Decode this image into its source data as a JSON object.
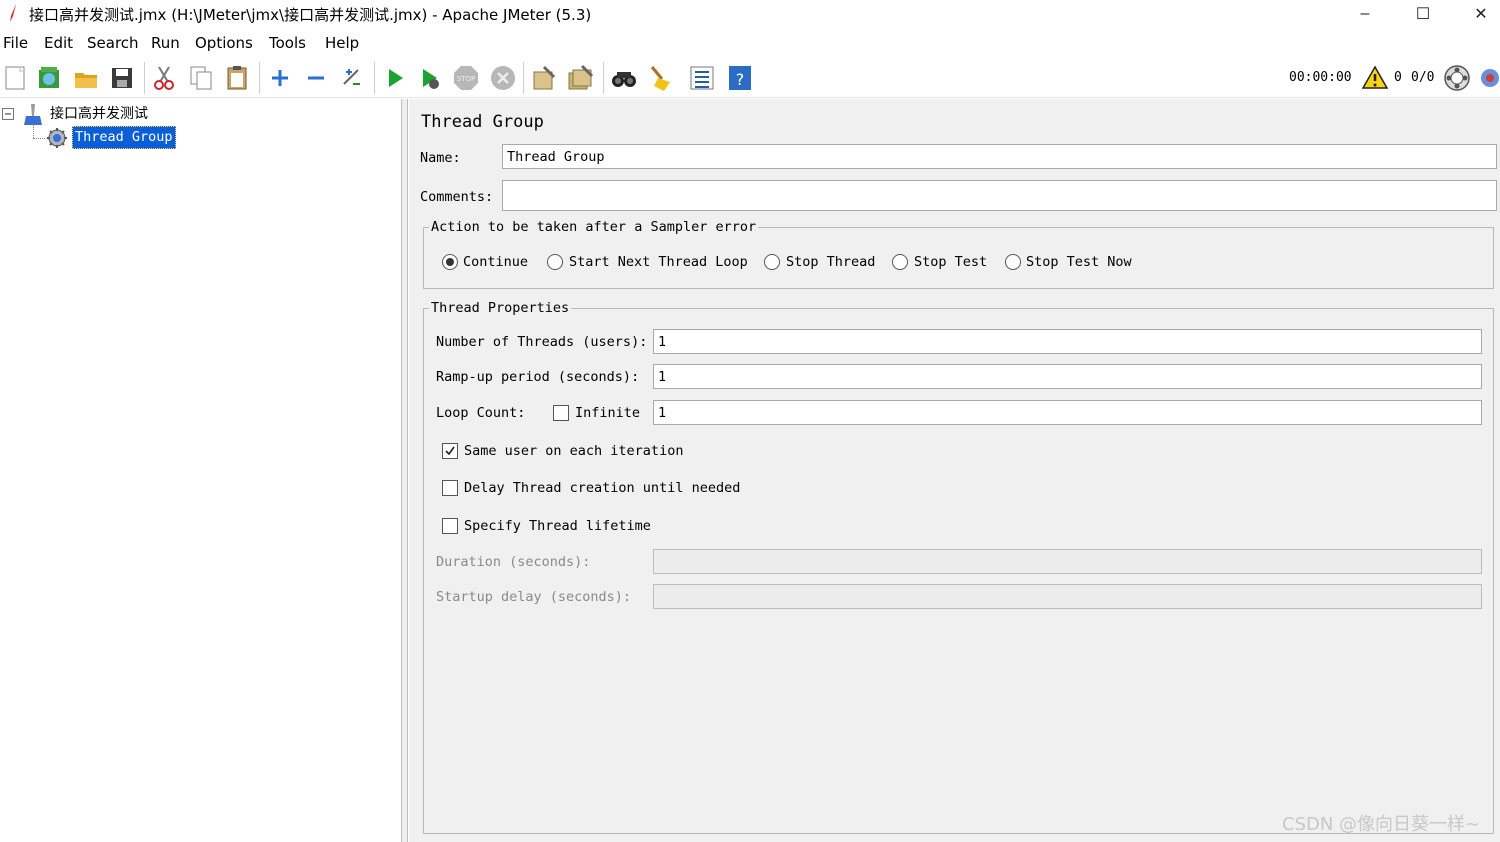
{
  "window": {
    "title": "接口高并发测试.jmx (H:\\JMeter\\jmx\\接口高并发测试.jmx) - Apache JMeter (5.3)",
    "controls": {
      "minimize": "–",
      "maximize": "☐",
      "close": "✕"
    }
  },
  "menu": [
    "File",
    "Edit",
    "Search",
    "Run",
    "Options",
    "Tools",
    "Help"
  ],
  "toolbar": {
    "timer": "00:00:00",
    "warning_count": "0",
    "thread_count": "0/0",
    "icons": [
      "new-icon",
      "templates-icon",
      "open-icon",
      "save-icon",
      "cut-icon",
      "copy-icon",
      "paste-icon",
      "expand-icon",
      "collapse-icon",
      "toggle-icon",
      "start-icon",
      "start-no-pause-icon",
      "stop-icon",
      "shutdown-icon",
      "clear-icon",
      "clear-all-icon",
      "search-icon",
      "reset-search-icon",
      "function-helper-icon",
      "help-icon"
    ]
  },
  "tree": {
    "root_label": "接口高并发测试",
    "child_label": "Thread Group"
  },
  "panel": {
    "title": "Thread Group",
    "name_label": "Name:",
    "name_value": "Thread Group",
    "comments_label": "Comments:",
    "comments_value": "",
    "sampler_error": {
      "legend": "Action to be taken after a Sampler error",
      "options": [
        "Continue",
        "Start Next Thread Loop",
        "Stop Thread",
        "Stop Test",
        "Stop Test Now"
      ],
      "selected": "Continue"
    },
    "thread_props": {
      "legend": "Thread Properties",
      "threads_label": "Number of Threads (users):",
      "threads_value": "1",
      "rampup_label": "Ramp-up period (seconds):",
      "rampup_value": "1",
      "loop_label": "Loop Count:",
      "infinite_label": "Infinite",
      "infinite_checked": false,
      "loop_value": "1",
      "same_user_label": "Same user on each iteration",
      "same_user_checked": true,
      "delay_label": "Delay Thread creation until needed",
      "delay_checked": false,
      "lifetime_label": "Specify Thread lifetime",
      "lifetime_checked": false,
      "duration_label": "Duration (seconds):",
      "duration_value": "",
      "startup_label": "Startup delay (seconds):",
      "startup_value": ""
    }
  },
  "watermark": "CSDN @像向日葵一样~",
  "colors": {
    "selection": "#0a5fd7",
    "panel_bg": "#f0f0f0",
    "play_green": "#1aa331"
  }
}
